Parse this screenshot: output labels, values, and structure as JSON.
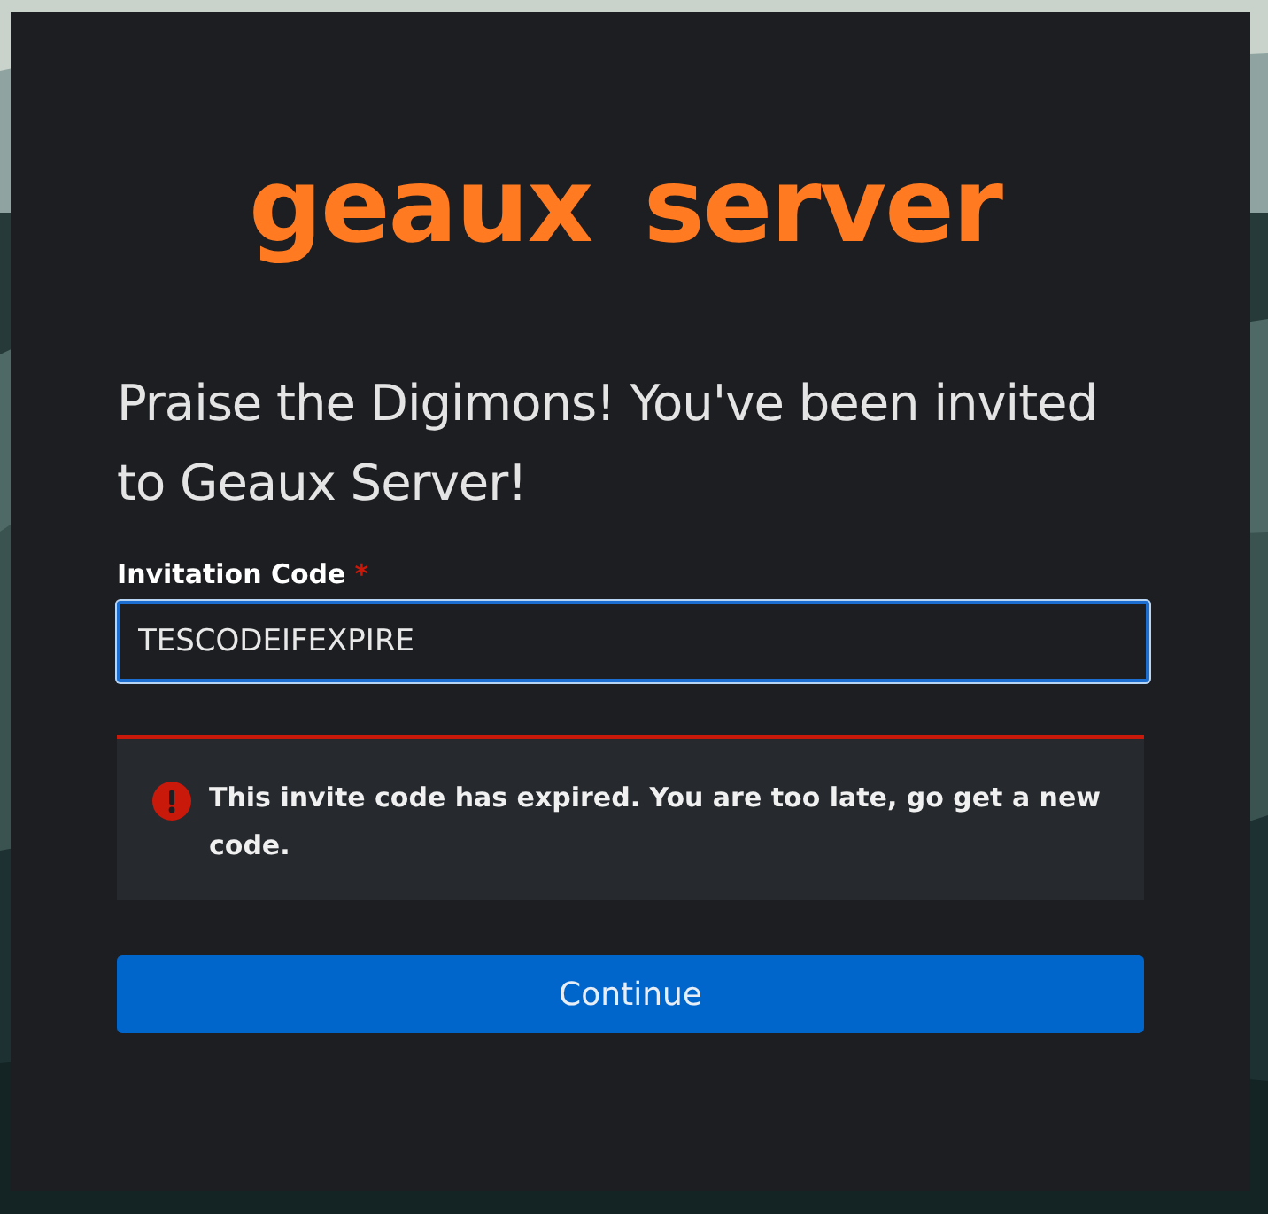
{
  "logo": "geaux server",
  "heading": "Praise the Digimons! You've been invited to Geaux Server!",
  "field": {
    "label": "Invitation Code",
    "required_mark": "*",
    "value": "TESCODEIFEXPIRE",
    "focused": true
  },
  "alert": {
    "kind": "danger",
    "message": "This invite code has expired. You are too late, go get a new code."
  },
  "button": "Continue"
}
